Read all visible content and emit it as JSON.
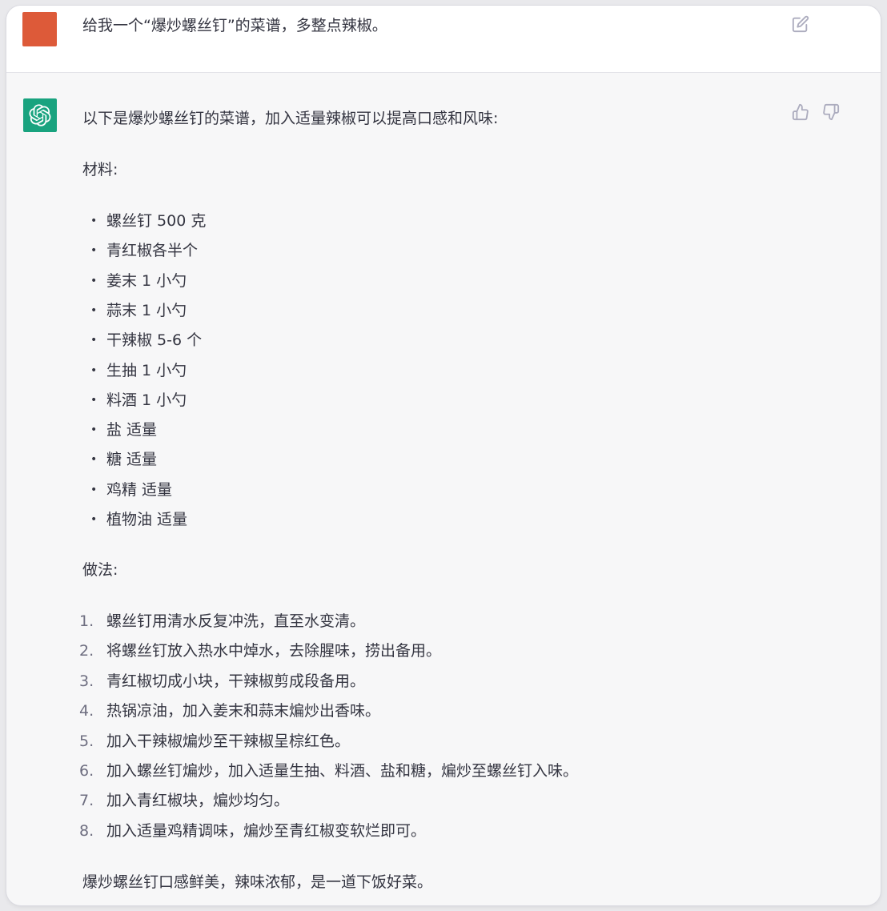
{
  "colors": {
    "user_avatar": "#dd5a39",
    "bot_avatar": "#19a37f",
    "text": "#343541",
    "icon": "#acacbe"
  },
  "icons": {
    "user_avatar": "user-avatar",
    "bot_avatar": "openai-logo-icon",
    "edit": "edit-icon",
    "thumbs_up": "thumbs-up-icon",
    "thumbs_down": "thumbs-down-icon"
  },
  "user": {
    "message": "给我一个“爆炒螺丝钉”的菜谱，多整点辣椒。"
  },
  "assistant": {
    "intro": "以下是爆炒螺丝钉的菜谱，加入适量辣椒可以提高口感和风味:",
    "materials_heading": "材料:",
    "materials": [
      "螺丝钉 500 克",
      "青红椒各半个",
      "姜末 1 小勺",
      "蒜末 1 小勺",
      "干辣椒 5-6 个",
      "生抽 1 小勺",
      "料酒 1 小勺",
      "盐 适量",
      "糖 适量",
      "鸡精 适量",
      "植物油 适量"
    ],
    "steps_heading": "做法:",
    "steps": [
      {
        "num": "1.",
        "text": "螺丝钉用清水反复冲洗，直至水变清。"
      },
      {
        "num": "2.",
        "text": "将螺丝钉放入热水中焯水，去除腥味，捞出备用。"
      },
      {
        "num": "3.",
        "text": "青红椒切成小块，干辣椒剪成段备用。"
      },
      {
        "num": "4.",
        "text": "热锅凉油，加入姜末和蒜末煸炒出香味。"
      },
      {
        "num": "5.",
        "text": "加入干辣椒煸炒至干辣椒呈棕红色。"
      },
      {
        "num": "6.",
        "text": "加入螺丝钉煸炒，加入适量生抽、料酒、盐和糖，煸炒至螺丝钉入味。"
      },
      {
        "num": "7.",
        "text": "加入青红椒块，煸炒均匀。"
      },
      {
        "num": "8.",
        "text": "加入适量鸡精调味，煸炒至青红椒变软烂即可。"
      }
    ],
    "closing": "爆炒螺丝钉口感鲜美，辣味浓郁，是一道下饭好菜。"
  }
}
